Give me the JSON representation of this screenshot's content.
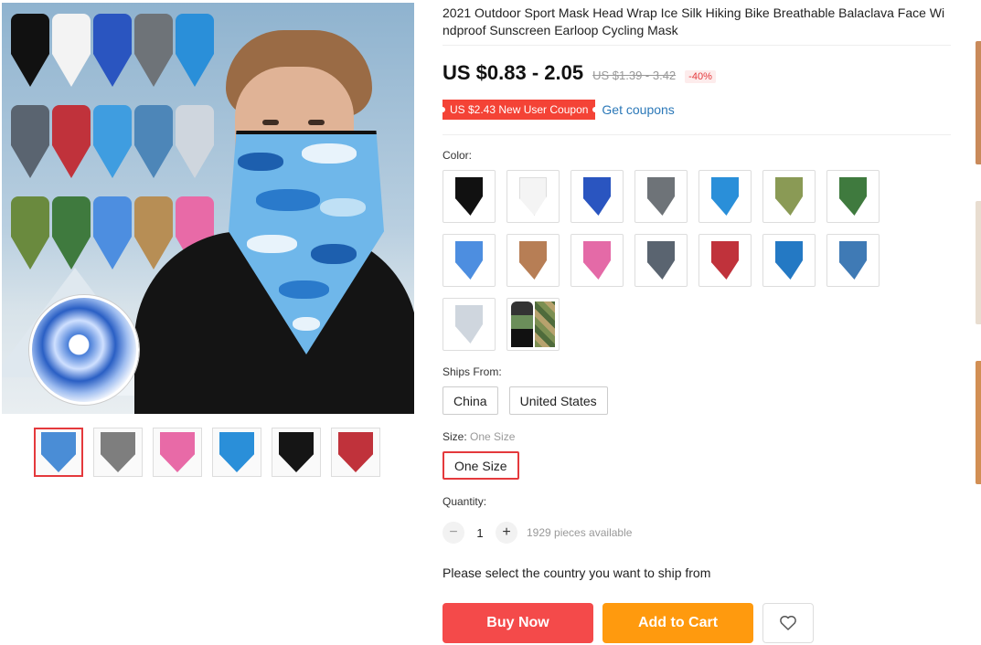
{
  "product": {
    "title": "2021 Outdoor Sport Mask Head Wrap Ice Silk Hiking Bike Breathable Balaclava Face Windproof Sunscreen Earloop Cycling Mask",
    "price": "US $0.83 - 2.05",
    "original_price": "US $1.39 - 3.42",
    "discount": "-40%",
    "coupon_label": "US $2.43 New User Coupon",
    "get_coupons": "Get coupons"
  },
  "color": {
    "label": "Color:",
    "swatches": [
      {
        "name": "black",
        "color": "#111111"
      },
      {
        "name": "white",
        "color": "#f4f4f4"
      },
      {
        "name": "blue",
        "color": "#2a55c0"
      },
      {
        "name": "gray",
        "color": "#6e7378"
      },
      {
        "name": "light-blue-camo",
        "color": "#2a8fd9"
      },
      {
        "name": "green-tan-camo",
        "color": "#8a9a55"
      },
      {
        "name": "green-camo",
        "color": "#3f7a3e"
      },
      {
        "name": "blue-camo",
        "color": "#4d8ee0"
      },
      {
        "name": "desert-camo",
        "color": "#b77e55"
      },
      {
        "name": "pink-camo",
        "color": "#e46aa7"
      },
      {
        "name": "gray-camo",
        "color": "#5a6470"
      },
      {
        "name": "red-camo",
        "color": "#c0323b"
      },
      {
        "name": "blue-digital-camo",
        "color": "#2479c4"
      },
      {
        "name": "steel-blue-camo",
        "color": "#3f7ab5"
      },
      {
        "name": "snow-camo",
        "color": "#cfd6de"
      },
      {
        "name": "combo",
        "color": "#555555"
      }
    ]
  },
  "ships_from": {
    "label": "Ships From:",
    "options": [
      "China",
      "United States"
    ]
  },
  "size": {
    "label": "Size:",
    "selected_text": "One Size",
    "options": [
      "One Size"
    ]
  },
  "quantity": {
    "label": "Quantity:",
    "minus": "−",
    "plus": "+",
    "value": "1",
    "available": "1929 pieces available"
  },
  "notice": "Please select the country you want to ship from",
  "actions": {
    "buy_now": "Buy Now",
    "add_to_cart": "Add to Cart"
  },
  "gallery": {
    "thumbnails": [
      {
        "name": "multi-color",
        "color": "#4a8dd6"
      },
      {
        "name": "man-grid",
        "color": "#7e7e7e"
      },
      {
        "name": "pink-camo",
        "color": "#e86aa7"
      },
      {
        "name": "blue-camo",
        "color": "#2a8fd9"
      },
      {
        "name": "black",
        "color": "#151515"
      },
      {
        "name": "red-person",
        "color": "#c0323b"
      }
    ]
  },
  "colors": {
    "accent": "#e4393c",
    "buy_now": "#f44a4a",
    "add_to_cart": "#ff9a0e",
    "link": "#2b78b8"
  }
}
